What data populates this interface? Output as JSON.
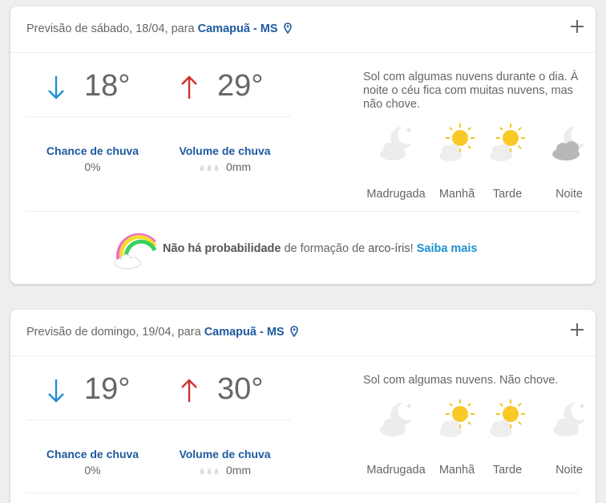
{
  "forecasts": [
    {
      "header_prefix": "Previsão de sábado, 18/04, para",
      "city": "Camapuã - MS",
      "temp_min": "18°",
      "temp_max": "29°",
      "chance_label": "Chance de chuva",
      "chance_value": "0%",
      "volume_label": "Volume de chuva",
      "volume_value": "0mm",
      "description": "Sol com algumas nuvens durante o dia. À noite o céu fica com muitas nuvens, mas não chove.",
      "periods": [
        {
          "label": "Madrugada",
          "icon": "moon-cloud-icon"
        },
        {
          "label": "Manhã",
          "icon": "sun-cloud-icon"
        },
        {
          "label": "Tarde",
          "icon": "sun-cloud-icon"
        },
        {
          "label": "Noite",
          "icon": "moon-dark-cloud-icon"
        }
      ],
      "rainbow": {
        "bold": "Não há probabilidade",
        "text1": " de formação de ",
        "bold2": "arco-íris",
        "text2": "! ",
        "link": "Saiba mais"
      }
    },
    {
      "header_prefix": "Previsão de domingo, 19/04, para",
      "city": "Camapuã - MS",
      "temp_min": "19°",
      "temp_max": "30°",
      "chance_label": "Chance de chuva",
      "chance_value": "0%",
      "volume_label": "Volume de chuva",
      "volume_value": "0mm",
      "description": "Sol com algumas nuvens. Não chove.",
      "periods": [
        {
          "label": "Madrugada",
          "icon": "moon-cloud-icon"
        },
        {
          "label": "Manhã",
          "icon": "sun-cloud-icon"
        },
        {
          "label": "Tarde",
          "icon": "sun-cloud-icon"
        },
        {
          "label": "Noite",
          "icon": "moon-cloud-icon"
        }
      ]
    }
  ],
  "colors": {
    "accent_blue": "#1d5aa0",
    "link_blue": "#1e8fd0",
    "arrow_down": "#1e8fd0",
    "arrow_up": "#d32f2f"
  }
}
